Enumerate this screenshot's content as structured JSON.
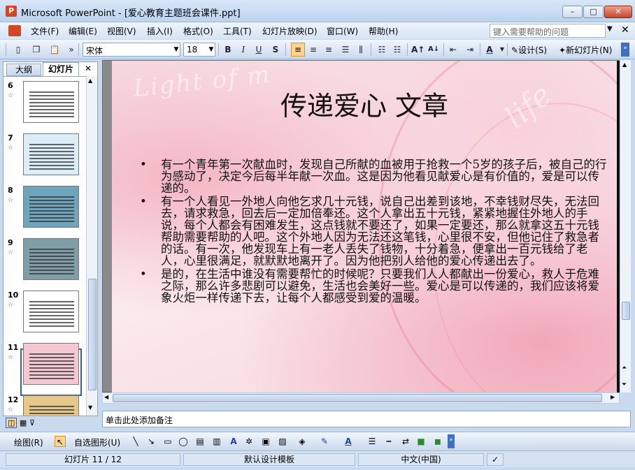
{
  "window": {
    "title": "Microsoft PowerPoint - [爱心教育主题班会课件.ppt]",
    "app_icon": "P"
  },
  "window_controls": {
    "minimize": "–",
    "maximize": "□",
    "close": "✕"
  },
  "menu": {
    "items": [
      "文件(F)",
      "编辑(E)",
      "视图(V)",
      "插入(I)",
      "格式(O)",
      "工具(T)",
      "幻灯片放映(D)",
      "窗口(W)",
      "帮助(H)"
    ],
    "help_placeholder": "键入需要帮助的问题"
  },
  "toolbar": {
    "font": "宋体",
    "size": "18",
    "bold": "B",
    "italic": "I",
    "underline": "U",
    "shadow": "S",
    "design_label": "设计(S)",
    "new_slide_label": "新幻灯片(N)"
  },
  "left_panel": {
    "tabs": [
      "大纲",
      "幻灯片"
    ],
    "close": "✕",
    "thumbnails": [
      {
        "num": "6",
        "bg": "#ffffff"
      },
      {
        "num": "7",
        "bg": "#dbeef8"
      },
      {
        "num": "8",
        "bg": "#6fa4bd"
      },
      {
        "num": "9",
        "bg": "#7f9fa8"
      },
      {
        "num": "10",
        "bg": "#ffffff"
      },
      {
        "num": "11",
        "bg": "#f4c8d2"
      },
      {
        "num": "12",
        "bg": "#e6c98a"
      }
    ],
    "selected": "11"
  },
  "slide": {
    "title": "传递爱心  文章",
    "deco_text": "Light of m",
    "deco_text2": "life",
    "bullets": [
      "有一个青年第一次献血时，发现自己所献的血被用于抢救一个5岁的孩子后，被自己的行为感动了，决定今后每半年献一次血。这是因为他看见献爱心是有价值的，爱是可以传递的。",
      "有一个人看见一外地人向他乞求几十元钱，说自己出差到该地，不幸钱财尽失，无法回去，请求救急，回去后一定加倍奉还。这个人拿出五十元钱，紧紧地握住外地人的手说，每个人都会有困难发生，这点钱就不要还了，如果一定要还，那么就拿这五十元钱帮助需要帮助的人吧。这个外地人因为无法还这笔钱，心里很不安，但他记住了救急者的话。有一次，他发现车上有一老人丢失了钱物，十分着急，便拿出一百元钱给了老人，心里很满足，就默默地离开了。因为他把别人给他的爱心传递出去了。",
      "是的，在生活中谁没有需要帮忙的时候呢？只要我们人人都献出一份爱心，救人于危难之际，那么许多悲剧可以避免，生活也会美好一些。爱心是可以传递的，我们应该将爱象火炬一样传递下去，让每个人都感受到爱的温暖。"
    ],
    "bullet_glyph": "•"
  },
  "notes": {
    "placeholder": "单击此处添加备注"
  },
  "draw_toolbar": {
    "draw_label": "绘图(R)",
    "autoshape_label": "自选图形(U)"
  },
  "status": {
    "slide_info": "幻灯片 11 / 12",
    "template": "默认设计模板",
    "language": "中文(中国)"
  }
}
